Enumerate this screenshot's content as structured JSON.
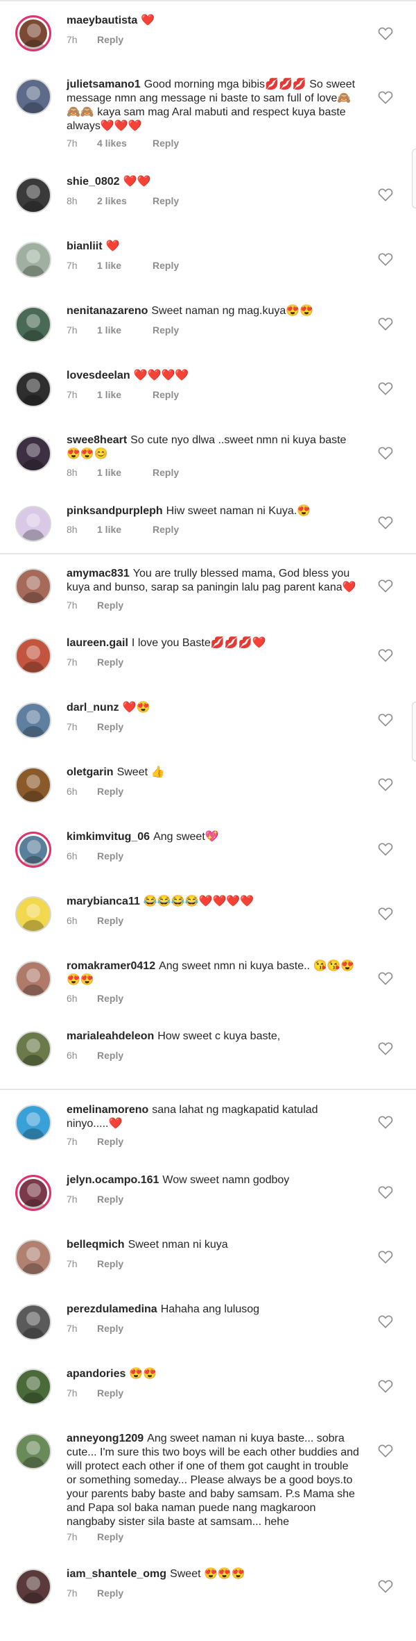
{
  "comments": [
    {
      "username": "maeybautista",
      "text": "❤️",
      "time": "7h",
      "likes": "",
      "reply": "Reply",
      "avatar_color": "#7a4a35",
      "story_ring": true
    },
    {
      "username": "julietsamano1",
      "text": "Good morning mga bibis💋💋💋 So sweet message nmn ang message ni baste to sam full of love🙈🙈🙈 kaya sam mag Aral mabuti and respect kuya baste always❤️❤️❤️",
      "time": "7h",
      "likes": "4 likes",
      "reply": "Reply",
      "avatar_color": "#5d6a8a",
      "story_ring": false
    },
    {
      "username": "shie_0802",
      "text": "❤️❤️",
      "time": "8h",
      "likes": "2 likes",
      "reply": "Reply",
      "avatar_color": "#3a3a3a",
      "story_ring": false
    },
    {
      "username": "bianliit",
      "text": "❤️",
      "time": "7h",
      "likes": "1 like",
      "reply": "Reply",
      "avatar_color": "#9fb0a0",
      "story_ring": false
    },
    {
      "username": "nenitanazareno",
      "text": "Sweet naman ng mag.kuya😍😍",
      "time": "7h",
      "likes": "1 like",
      "reply": "Reply",
      "avatar_color": "#4a6a55",
      "story_ring": false
    },
    {
      "username": "lovesdeelan",
      "text": "❤️❤️❤️❤️",
      "time": "7h",
      "likes": "1 like",
      "reply": "Reply",
      "avatar_color": "#2e2e2e",
      "story_ring": false
    },
    {
      "username": "swee8heart",
      "text": "So cute nyo dlwa ..sweet nmn ni kuya baste 😍😍😊",
      "time": "8h",
      "likes": "1 like",
      "reply": "Reply",
      "avatar_color": "#3d3042",
      "story_ring": false
    },
    {
      "username": "pinksandpurpleph",
      "text": "Hiw sweet naman ni Kuya.😍",
      "time": "8h",
      "likes": "1 like",
      "reply": "Reply",
      "avatar_color": "#d9c8e6",
      "story_ring": false
    },
    {
      "username": "amymac831",
      "text": "You are trully blessed mama, God bless you kuya and bunso, sarap sa paningin lalu pag parent kana❤️",
      "time": "7h",
      "likes": "",
      "reply": "Reply",
      "avatar_color": "#a56a5a",
      "story_ring": false
    },
    {
      "username": "laureen.gail",
      "text": "I love you Baste💋💋💋❤️",
      "time": "7h",
      "likes": "",
      "reply": "Reply",
      "avatar_color": "#c2553f",
      "story_ring": false
    },
    {
      "username": "darl_nunz",
      "text": "❤️😍",
      "time": "7h",
      "likes": "",
      "reply": "Reply",
      "avatar_color": "#5f7fa0",
      "story_ring": false
    },
    {
      "username": "oletgarin",
      "text": "Sweet 👍",
      "time": "6h",
      "likes": "",
      "reply": "Reply",
      "avatar_color": "#8a5a2a",
      "story_ring": false
    },
    {
      "username": "kimkimvitug_06",
      "text": "Ang sweet💖",
      "time": "6h",
      "likes": "",
      "reply": "Reply",
      "avatar_color": "#5a7f9a",
      "story_ring": true
    },
    {
      "username": "marybianca11",
      "text": "😂😂😂😂❤️❤️❤️❤️",
      "time": "6h",
      "likes": "",
      "reply": "Reply",
      "avatar_color": "#f2d84f",
      "story_ring": false
    },
    {
      "username": "romakramer0412",
      "text": "Ang sweet nmn ni kuya baste.. 😘😘😍😍😍",
      "time": "6h",
      "likes": "",
      "reply": "Reply",
      "avatar_color": "#b07a6a",
      "story_ring": false
    },
    {
      "username": "marialeahdeleon",
      "text": "How sweet c kuya baste,",
      "time": "6h",
      "likes": "",
      "reply": "Reply",
      "avatar_color": "#6a7a4a",
      "story_ring": false
    },
    {
      "username": "emelinamoreno",
      "text": "sana lahat ng magkapatid katulad ninyo.....❤️",
      "time": "7h",
      "likes": "",
      "reply": "Reply",
      "avatar_color": "#3aa0d8",
      "story_ring": false
    },
    {
      "username": "jelyn.ocampo.161",
      "text": "Wow sweet namn godboy",
      "time": "7h",
      "likes": "",
      "reply": "Reply",
      "avatar_color": "#7a3a4a",
      "story_ring": true
    },
    {
      "username": "belleqmich",
      "text": "Sweet nman ni kuya",
      "time": "7h",
      "likes": "",
      "reply": "Reply",
      "avatar_color": "#b08070",
      "story_ring": false
    },
    {
      "username": "perezdulamedina",
      "text": "Hahaha ang lulusog",
      "time": "7h",
      "likes": "",
      "reply": "Reply",
      "avatar_color": "#5a5a5a",
      "story_ring": false
    },
    {
      "username": "apandories",
      "text": "😍😍",
      "time": "7h",
      "likes": "",
      "reply": "Reply",
      "avatar_color": "#4a6a3a",
      "story_ring": false
    },
    {
      "username": "anneyong1209",
      "text": "Ang sweet naman ni kuya baste... sobra cute... I'm sure this two boys will be each other buddies and will protect each other if one of them got caught in trouble or something someday... Please always be a good boys.to your parents baby baste and baby samsam. P.s Mama she and Papa sol baka naman puede nang magkaroon nangbaby sister sila baste at samsam... hehe",
      "time": "7h",
      "likes": "",
      "reply": "Reply",
      "avatar_color": "#6a8a5a",
      "story_ring": false
    },
    {
      "username": "iam_shantele_omg",
      "text": "Sweet 😍😍😍",
      "time": "7h",
      "likes": "",
      "reply": "Reply",
      "avatar_color": "#5a3a3a",
      "story_ring": false
    }
  ]
}
